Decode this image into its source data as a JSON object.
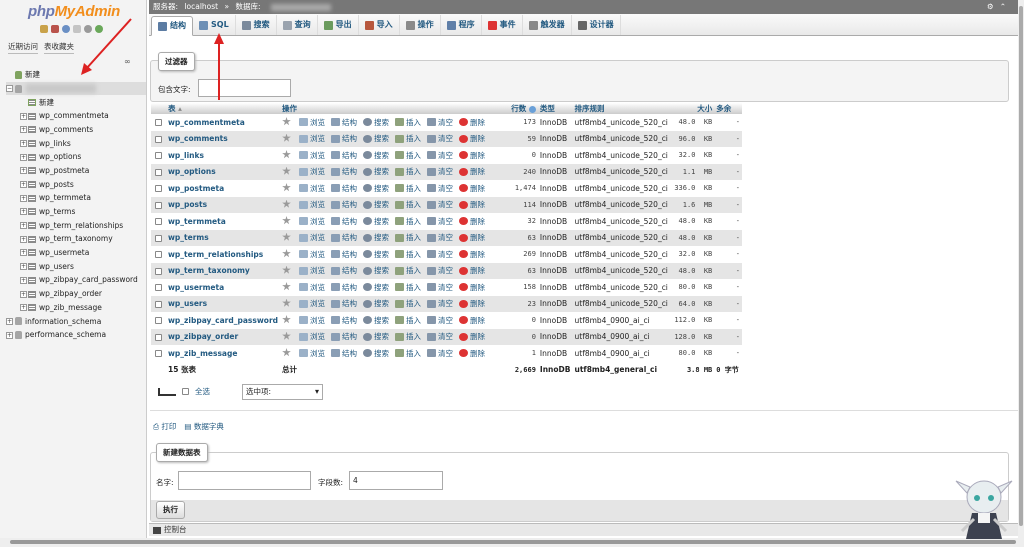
{
  "app": {
    "logo_php": "php",
    "logo_my": "MyAdmin"
  },
  "nav": {
    "tabs": [
      "近期访问",
      "表收藏夹"
    ],
    "new_label": "新建",
    "db_new_label": "新建",
    "tables": [
      "wp_commentmeta",
      "wp_comments",
      "wp_links",
      "wp_options",
      "wp_postmeta",
      "wp_posts",
      "wp_termmeta",
      "wp_terms",
      "wp_term_relationships",
      "wp_term_taxonomy",
      "wp_usermeta",
      "wp_users",
      "wp_zibpay_card_password",
      "wp_zibpay_order",
      "wp_zib_message"
    ],
    "other_dbs": [
      "information_schema",
      "performance_schema"
    ]
  },
  "breadcrumb": {
    "server_label": "服务器:",
    "server": "localhost",
    "sep": "»",
    "db_label": "数据库:"
  },
  "tabs": [
    {
      "label": "结构",
      "icon": "structure-icon",
      "color": "#5c7ca3"
    },
    {
      "label": "SQL",
      "icon": "sql-icon",
      "color": "#6d8fb5"
    },
    {
      "label": "搜索",
      "icon": "search-icon",
      "color": "#7b8a9c"
    },
    {
      "label": "查询",
      "icon": "query-icon",
      "color": "#9aa3ae"
    },
    {
      "label": "导出",
      "icon": "export-icon",
      "color": "#6b9b5e"
    },
    {
      "label": "导入",
      "icon": "import-icon",
      "color": "#b7573d"
    },
    {
      "label": "操作",
      "icon": "wrench-icon",
      "color": "#8a8a8a"
    },
    {
      "label": "程序",
      "icon": "routines-icon",
      "color": "#5f7fa8"
    },
    {
      "label": "事件",
      "icon": "events-icon",
      "color": "#d33"
    },
    {
      "label": "触发器",
      "icon": "triggers-icon",
      "color": "#888"
    },
    {
      "label": "设计器",
      "icon": "designer-icon",
      "color": "#666"
    }
  ],
  "filter": {
    "legend": "过滤器",
    "label": "包含文字:",
    "value": ""
  },
  "table": {
    "headers": {
      "table": "表",
      "action": "操作",
      "rows": "行数",
      "type": "类型",
      "collation": "排序规则",
      "size": "大小",
      "overhead": "多余"
    },
    "actions": [
      "浏览",
      "结构",
      "搜索",
      "插入",
      "清空",
      "删除"
    ],
    "rows": [
      {
        "name": "wp_commentmeta",
        "rows": "173",
        "type": "InnoDB",
        "collation": "utf8mb4_unicode_520_ci",
        "size": "48.0",
        "unit": "KB",
        "overhead": "-"
      },
      {
        "name": "wp_comments",
        "rows": "59",
        "type": "InnoDB",
        "collation": "utf8mb4_unicode_520_ci",
        "size": "96.0",
        "unit": "KB",
        "overhead": "-"
      },
      {
        "name": "wp_links",
        "rows": "0",
        "type": "InnoDB",
        "collation": "utf8mb4_unicode_520_ci",
        "size": "32.0",
        "unit": "KB",
        "overhead": "-"
      },
      {
        "name": "wp_options",
        "rows": "240",
        "type": "InnoDB",
        "collation": "utf8mb4_unicode_520_ci",
        "size": "1.1",
        "unit": "MB",
        "overhead": "-"
      },
      {
        "name": "wp_postmeta",
        "rows": "1,474",
        "type": "InnoDB",
        "collation": "utf8mb4_unicode_520_ci",
        "size": "336.0",
        "unit": "KB",
        "overhead": "-"
      },
      {
        "name": "wp_posts",
        "rows": "114",
        "type": "InnoDB",
        "collation": "utf8mb4_unicode_520_ci",
        "size": "1.6",
        "unit": "MB",
        "overhead": "-"
      },
      {
        "name": "wp_termmeta",
        "rows": "32",
        "type": "InnoDB",
        "collation": "utf8mb4_unicode_520_ci",
        "size": "48.0",
        "unit": "KB",
        "overhead": "-"
      },
      {
        "name": "wp_terms",
        "rows": "63",
        "type": "InnoDB",
        "collation": "utf8mb4_unicode_520_ci",
        "size": "48.0",
        "unit": "KB",
        "overhead": "-"
      },
      {
        "name": "wp_term_relationships",
        "rows": "269",
        "type": "InnoDB",
        "collation": "utf8mb4_unicode_520_ci",
        "size": "32.0",
        "unit": "KB",
        "overhead": "-"
      },
      {
        "name": "wp_term_taxonomy",
        "rows": "63",
        "type": "InnoDB",
        "collation": "utf8mb4_unicode_520_ci",
        "size": "48.0",
        "unit": "KB",
        "overhead": "-"
      },
      {
        "name": "wp_usermeta",
        "rows": "158",
        "type": "InnoDB",
        "collation": "utf8mb4_unicode_520_ci",
        "size": "80.0",
        "unit": "KB",
        "overhead": "-"
      },
      {
        "name": "wp_users",
        "rows": "23",
        "type": "InnoDB",
        "collation": "utf8mb4_unicode_520_ci",
        "size": "64.0",
        "unit": "KB",
        "overhead": "-"
      },
      {
        "name": "wp_zibpay_card_password",
        "rows": "0",
        "type": "InnoDB",
        "collation": "utf8mb4_0900_ai_ci",
        "size": "112.0",
        "unit": "KB",
        "overhead": "-"
      },
      {
        "name": "wp_zibpay_order",
        "rows": "0",
        "type": "InnoDB",
        "collation": "utf8mb4_0900_ai_ci",
        "size": "128.0",
        "unit": "KB",
        "overhead": "-"
      },
      {
        "name": "wp_zib_message",
        "rows": "1",
        "type": "InnoDB",
        "collation": "utf8mb4_0900_ai_ci",
        "size": "80.0",
        "unit": "KB",
        "overhead": "-"
      }
    ],
    "footer": {
      "count": "15 张表",
      "sum_label": "总计",
      "rows": "2,669",
      "type": "InnoDB",
      "collation": "utf8mb4_general_ci",
      "size": "3.8",
      "unit": "MB",
      "overhead": "0 字节"
    }
  },
  "bulk": {
    "check_all": "全选",
    "with_selected": "选中项:"
  },
  "links": {
    "print": "打印",
    "dictionary": "数据字典"
  },
  "create": {
    "legend": "新建数据表",
    "name_label": "名字:",
    "name_value": "",
    "cols_label": "字段数:",
    "cols_value": "4",
    "go": "执行"
  },
  "console": {
    "label": "控制台"
  },
  "annotation_color": "#d22"
}
